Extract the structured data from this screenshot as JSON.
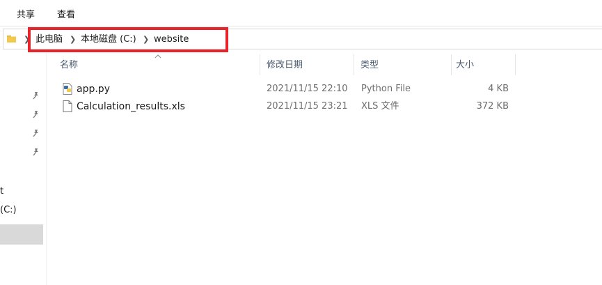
{
  "ribbon": {
    "tabs": [
      {
        "label": "共享"
      },
      {
        "label": "查看"
      }
    ]
  },
  "address": {
    "crumbs": [
      {
        "label": "此电脑"
      },
      {
        "label": "本地磁盘 (C:)"
      },
      {
        "label": "website"
      }
    ],
    "highlight_color": "#e8242b"
  },
  "nav": {
    "partial_items": [
      {
        "label": "t"
      },
      {
        "label": "(C:)"
      }
    ],
    "pinned_icon": "pin-icon"
  },
  "columns": [
    {
      "label": "名称"
    },
    {
      "label": "修改日期"
    },
    {
      "label": "类型"
    },
    {
      "label": "大小"
    }
  ],
  "files": [
    {
      "name": "app.py",
      "modified": "2021/11/15 22:10",
      "type": "Python File",
      "size": "4 KB",
      "icon": "python-file-icon"
    },
    {
      "name": "Calculation_results.xls",
      "modified": "2021/11/15 23:21",
      "type": "XLS 文件",
      "size": "372 KB",
      "icon": "document-file-icon"
    }
  ]
}
